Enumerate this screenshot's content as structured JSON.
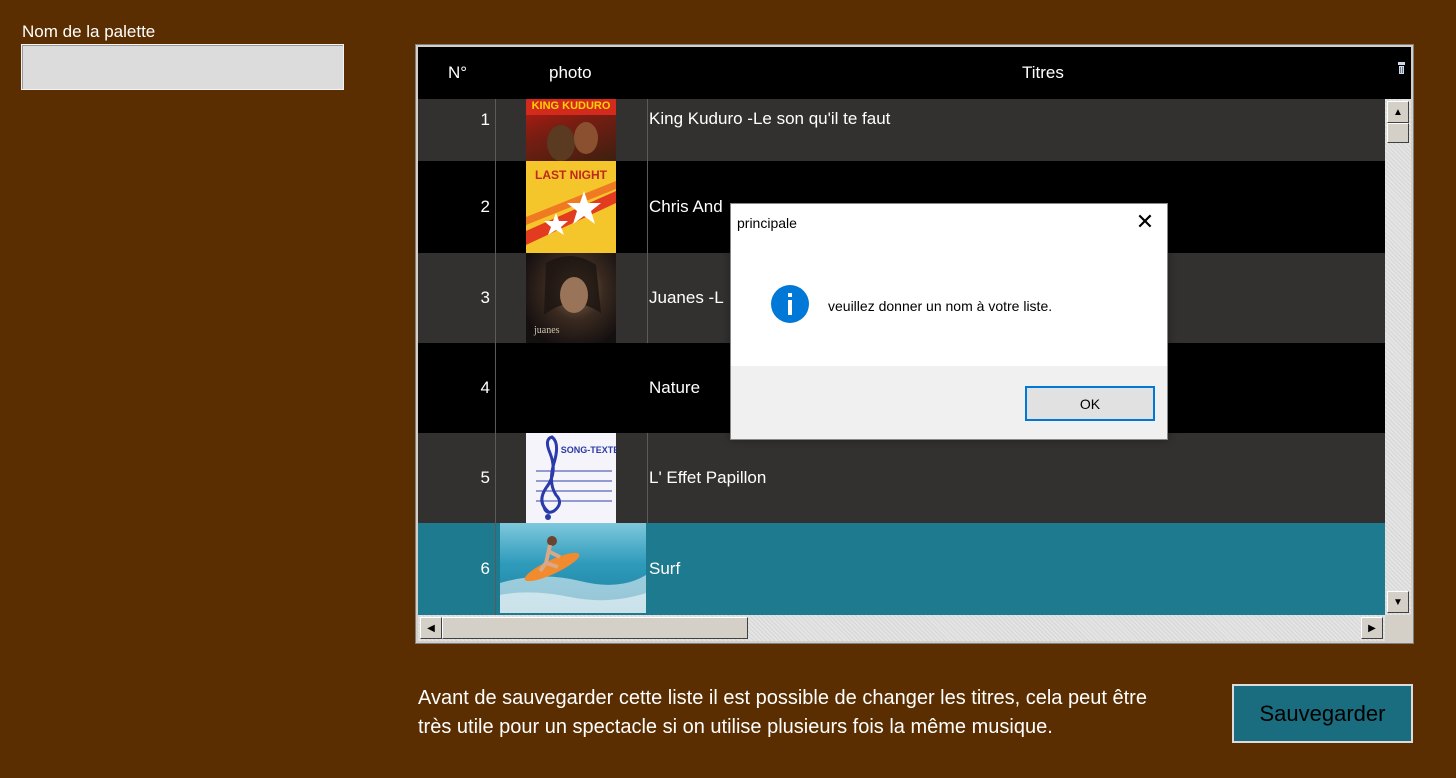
{
  "palette": {
    "label": "Nom de la palette",
    "value": ""
  },
  "grid": {
    "headers": {
      "num": "N°",
      "photo": "photo",
      "titles": "Titres"
    },
    "rows": [
      {
        "num": "1",
        "title": "King Kuduro -Le son qu'il te faut",
        "thumb_text": "KING KUDURO"
      },
      {
        "num": "2",
        "title": "Chris And",
        "thumb_text": "LAST NIGHT"
      },
      {
        "num": "3",
        "title": "Juanes -L",
        "thumb_text": "juanes"
      },
      {
        "num": "4",
        "title": "Nature",
        "thumb_text": ""
      },
      {
        "num": "5",
        "title": "L' Effet Papillon",
        "thumb_text": "SONG-TEXTE"
      },
      {
        "num": "6",
        "title": "Surf",
        "thumb_text": ""
      }
    ],
    "selected_row": "6"
  },
  "info_text": "Avant de sauvegarder cette liste il est possible de changer les titres, cela peut être très utile pour un spectacle si on utilise plusieurs fois la même musique.",
  "save_button": "Sauvegarder",
  "dialog": {
    "title": "principale",
    "message": "veuillez donner un nom à votre liste.",
    "ok_label": "OK",
    "icon": "info-icon"
  },
  "colors": {
    "background": "#5a2e00",
    "row_dark": "#333030",
    "row_black": "#000000",
    "row_selected": "#1e7a8e",
    "save_button": "#1a6d7e",
    "dialog_accent": "#0078d7"
  }
}
